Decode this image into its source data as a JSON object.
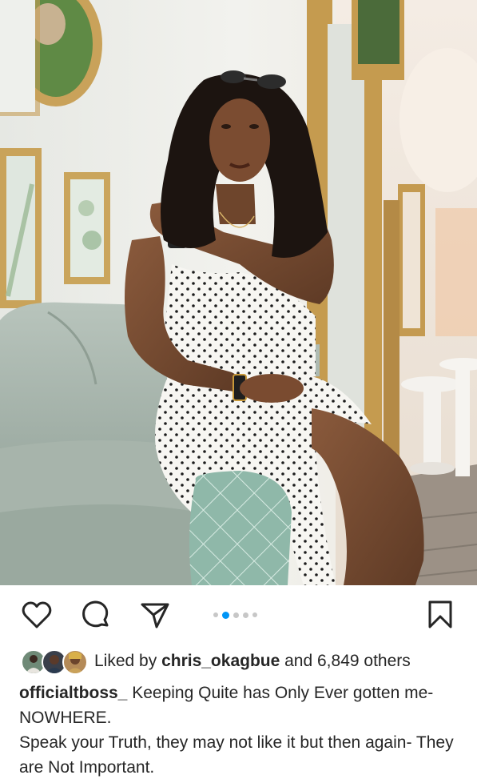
{
  "post": {
    "image_alt": "Woman in white polka-dot dress seated on a pale green armchair",
    "carousel": {
      "count": 5,
      "active_index": 1
    }
  },
  "likes": {
    "prefix": "Liked by ",
    "user": "chris_okagbue",
    "suffix": " and 6,849 others"
  },
  "caption": {
    "username": "officialtboss_",
    "line1": " Keeping Quite has Only Ever gotten me- NOWHERE.",
    "line2": " Speak your Truth, they may not like it but then again- They are Not Important."
  },
  "icons": {
    "like": "heart-icon",
    "comment": "comment-bubble-icon",
    "share": "paper-plane-icon",
    "save": "bookmark-icon"
  },
  "colors": {
    "active_dot": "#0095f6",
    "inactive_dot": "#c7c7c7",
    "text": "#262626"
  }
}
